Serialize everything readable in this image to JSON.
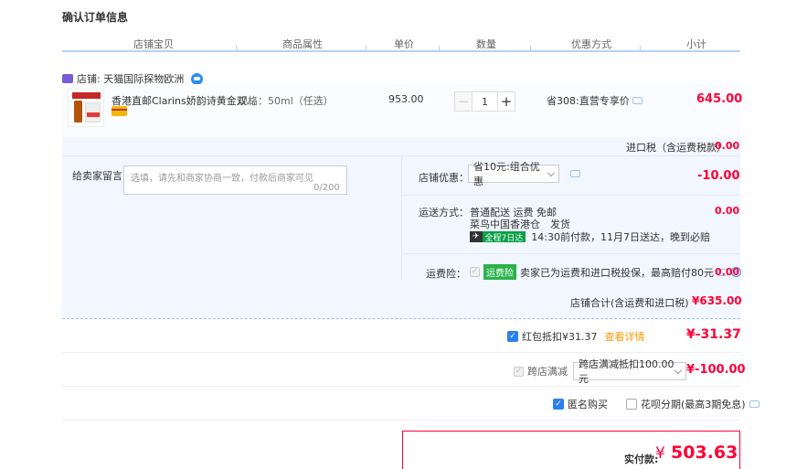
{
  "page": {
    "title": "确认订单信息"
  },
  "columns": [
    "店铺宝贝",
    "商品属性",
    "单价",
    "数量",
    "优惠方式",
    "小计"
  ],
  "shop": {
    "label": "店铺: 天猫国际探物欧洲"
  },
  "item": {
    "title": "香港直邮Clarins娇韵诗黄金双...",
    "spec": "规格：50ml（任选）",
    "unit_price": "953.00",
    "quantity": "1",
    "minus": "−",
    "plus": "+",
    "discount": "省308:直营专享价",
    "subtotal": "645.00"
  },
  "tax": {
    "label": "进口税（含运费税款）",
    "value": "0.00"
  },
  "message": {
    "label": "给卖家留言：",
    "placeholder": "选填，请先和商家协商一致，付款后商家可见",
    "count": "0/200"
  },
  "shop_discount": {
    "label": "店铺优惠：",
    "selected": "省10元:组合优惠",
    "value": "-10.00"
  },
  "shipping": {
    "label": "运送方式：",
    "line1": "普通配送 运费 免邮",
    "line2": "菜鸟中国香港仓　发货",
    "badge_a": "✈",
    "badge_b": "全程7日达",
    "line3": "14:30前付款，11月7日送达，晚到必赔",
    "value": "0.00"
  },
  "insurance": {
    "label": "运费险：",
    "badge": "运费险",
    "text": "卖家已为运费和进口税投保，最高赔付80元",
    "help": "?",
    "value": "0.00"
  },
  "shop_total": {
    "label": "店铺合计(含运费和进口税)",
    "value": "¥635.00"
  },
  "redpack": {
    "check": "✓",
    "text": "红包抵扣¥31.37",
    "detail": "查看详情",
    "value": "¥-31.37"
  },
  "cross_store": {
    "check": "✓",
    "label": "跨店满减",
    "selected": "跨店满减抵扣100.00元",
    "value": "¥-100.00"
  },
  "anonymous": {
    "check": "✓",
    "label": "匿名购买"
  },
  "huabei": {
    "label": "花呗分期(最高3期免息)"
  },
  "payment": {
    "label": "实付款:",
    "currency": "¥",
    "value": "503.63"
  }
}
